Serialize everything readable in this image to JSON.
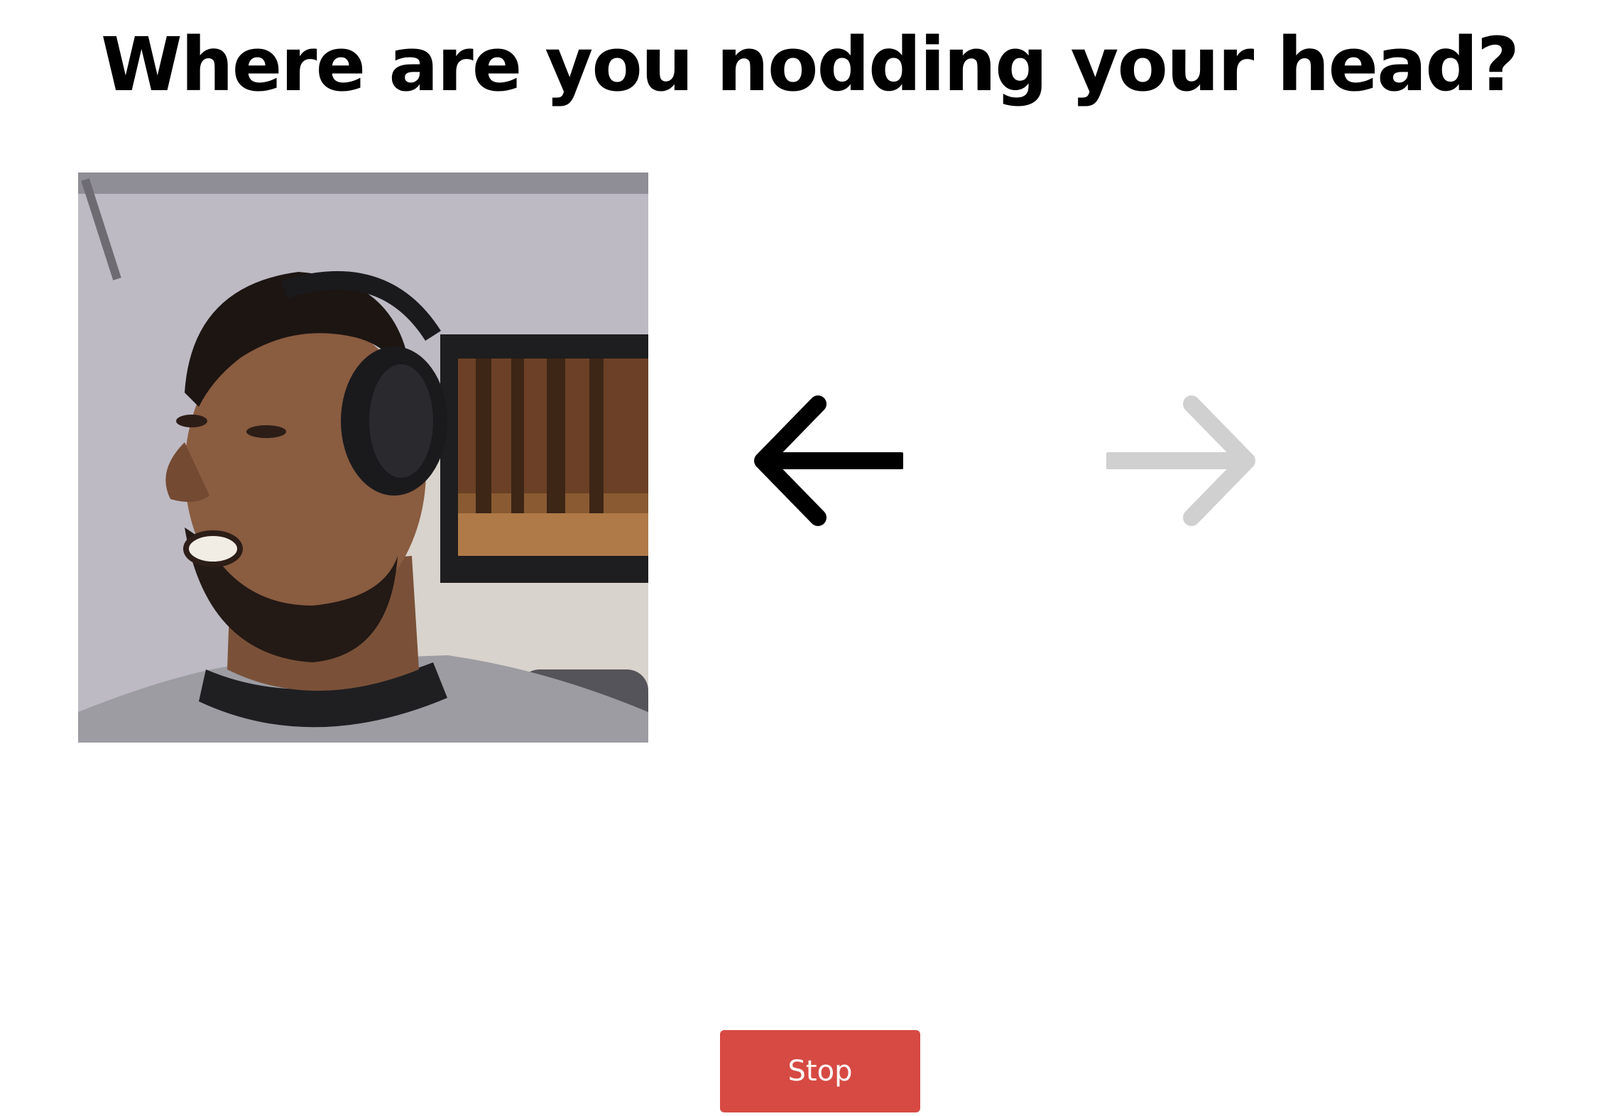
{
  "prompt": {
    "title": "Where are you nodding your head?"
  },
  "camera_feed": {
    "alt": "Webcam video of user wearing headphones"
  },
  "direction_indicators": {
    "left_arrow": {
      "icon": "arrow-left-icon",
      "state": "active",
      "color": "#000000"
    },
    "right_arrow": {
      "icon": "arrow-right-icon",
      "state": "inactive",
      "color": "#d0d0d0"
    }
  },
  "controls": {
    "stop_label": "Stop",
    "stop_color": "#d64a43"
  }
}
